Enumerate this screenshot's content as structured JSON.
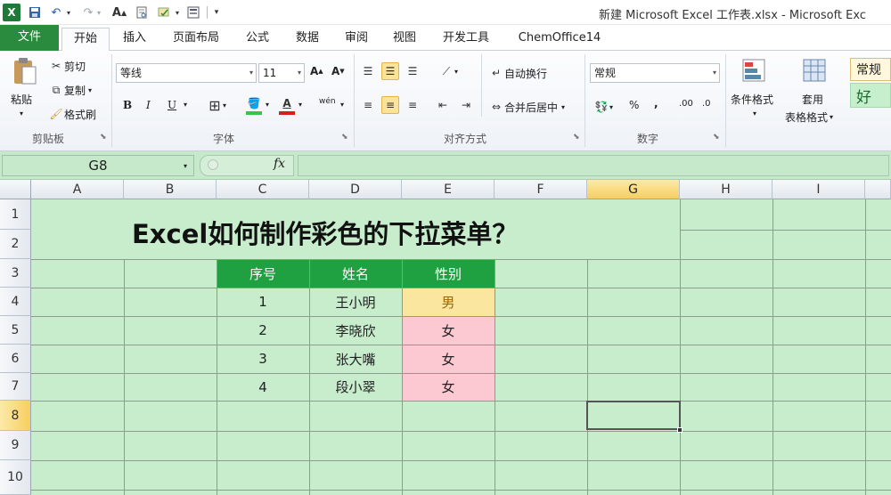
{
  "app": {
    "window_title": "新建 Microsoft Excel 工作表.xlsx - Microsoft Exc",
    "logo_letter": "X"
  },
  "quick_access": [
    "save-icon",
    "undo-icon",
    "redo-icon",
    "font-grow-icon",
    "preview-icon",
    "spellcheck-icon",
    "form-icon"
  ],
  "tabs": [
    {
      "label": "文件",
      "active": false
    },
    {
      "label": "开始",
      "active": true
    },
    {
      "label": "插入",
      "active": false
    },
    {
      "label": "页面布局",
      "active": false
    },
    {
      "label": "公式",
      "active": false
    },
    {
      "label": "数据",
      "active": false
    },
    {
      "label": "审阅",
      "active": false
    },
    {
      "label": "视图",
      "active": false
    },
    {
      "label": "开发工具",
      "active": false
    },
    {
      "label": "ChemOffice14",
      "active": false
    }
  ],
  "ribbon": {
    "clipboard": {
      "label": "剪贴板",
      "paste": "粘贴",
      "cut": "剪切",
      "copy": "复制",
      "format_painter": "格式刷"
    },
    "font": {
      "label": "字体",
      "font_name": "等线",
      "font_size": "11",
      "bold": "B",
      "italic": "I",
      "underline": "U",
      "phonetic": "wén"
    },
    "alignment": {
      "label": "对齐方式",
      "wrap_text": "自动换行",
      "merge_center": "合并后居中"
    },
    "number": {
      "label": "数字",
      "format": "常规",
      "percent": "%",
      "comma": ","
    },
    "styles": {
      "conditional_format": "条件格式",
      "table_format_1": "套用",
      "table_format_2": "表格格式",
      "style_normal": "常规",
      "style_good": "好"
    }
  },
  "formula_bar": {
    "name_box": "G8",
    "fx_label": "fx",
    "formula": ""
  },
  "sheet": {
    "columns": [
      "A",
      "B",
      "C",
      "D",
      "E",
      "F",
      "G",
      "H",
      "I"
    ],
    "rows": [
      "1",
      "2",
      "3",
      "4",
      "5",
      "6",
      "7",
      "8",
      "9",
      "10"
    ],
    "selected_cell": "G8",
    "title": "Excel如何制作彩色的下拉菜单？",
    "table_headers": [
      "序号",
      "姓名",
      "性别"
    ],
    "table_rows": [
      {
        "no": "1",
        "name": "王小明",
        "gender": "男"
      },
      {
        "no": "2",
        "name": "李晓欣",
        "gender": "女"
      },
      {
        "no": "3",
        "name": "张大嘴",
        "gender": "女"
      },
      {
        "no": "4",
        "name": "段小翠",
        "gender": "女"
      }
    ]
  },
  "colors": {
    "sheet_bg": "#c7edcc",
    "header_green": "#1fa141",
    "male_fill": "#fbe6a0",
    "female_fill": "#fcc8d2",
    "file_tab": "#2a8a3e"
  }
}
